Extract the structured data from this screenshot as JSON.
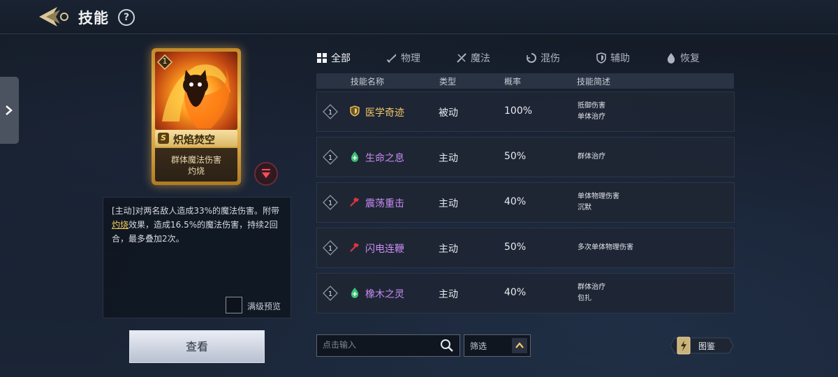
{
  "header": {
    "title": "技能",
    "help_label": "?"
  },
  "card": {
    "level": "1",
    "rank": "S",
    "name": "炽焰焚空",
    "desc_line1": "群体魔法伤害",
    "desc_line2": "灼烧"
  },
  "description": {
    "part1": "[主动]对两名敌人造成33%的魔法伤害。附带",
    "highlight": "灼烧",
    "part2": "效果，造成16.5%的魔法伤害，持续2回合，最多叠加2次。",
    "max_level_preview": "满级预览"
  },
  "view_button": "查看",
  "tabs": [
    {
      "label": "全部",
      "icon": "grid-icon",
      "active": true
    },
    {
      "label": "物理",
      "icon": "sword-icon",
      "active": false
    },
    {
      "label": "魔法",
      "icon": "magic-wand-icon",
      "active": false
    },
    {
      "label": "混伤",
      "icon": "swirl-icon",
      "active": false
    },
    {
      "label": "辅助",
      "icon": "shield-icon",
      "active": false
    },
    {
      "label": "恢复",
      "icon": "drop-icon",
      "active": false
    }
  ],
  "table": {
    "headers": {
      "name": "技能名称",
      "type": "类型",
      "rate": "概率",
      "summary": "技能简述"
    },
    "rows": [
      {
        "level": "1",
        "name": "医学奇迹",
        "name_color": "#f0c86a",
        "icon": "shield-icon",
        "type": "被动",
        "rate": "100%",
        "summary": [
          "抵御伤害",
          "单体治疗"
        ]
      },
      {
        "level": "1",
        "name": "生命之息",
        "name_color": "#c88cf2",
        "icon": "leaf-drop-icon",
        "type": "主动",
        "rate": "50%",
        "summary": [
          "群体治疗"
        ]
      },
      {
        "level": "1",
        "name": "震荡重击",
        "name_color": "#c88cf2",
        "icon": "hammer-icon",
        "type": "主动",
        "rate": "40%",
        "summary": [
          "单体物理伤害",
          "沉默"
        ]
      },
      {
        "level": "1",
        "name": "闪电连鞭",
        "name_color": "#c88cf2",
        "icon": "hammer-icon",
        "type": "主动",
        "rate": "50%",
        "summary": [
          "多次单体物理伤害"
        ]
      },
      {
        "level": "1",
        "name": "橡木之灵",
        "name_color": "#c88cf2",
        "icon": "leaf-drop-icon",
        "type": "主动",
        "rate": "40%",
        "summary": [
          "群体治疗",
          "包扎"
        ]
      }
    ]
  },
  "search": {
    "placeholder": "点击输入"
  },
  "filter": {
    "label": "筛选"
  },
  "codex": {
    "label": "图鉴"
  }
}
